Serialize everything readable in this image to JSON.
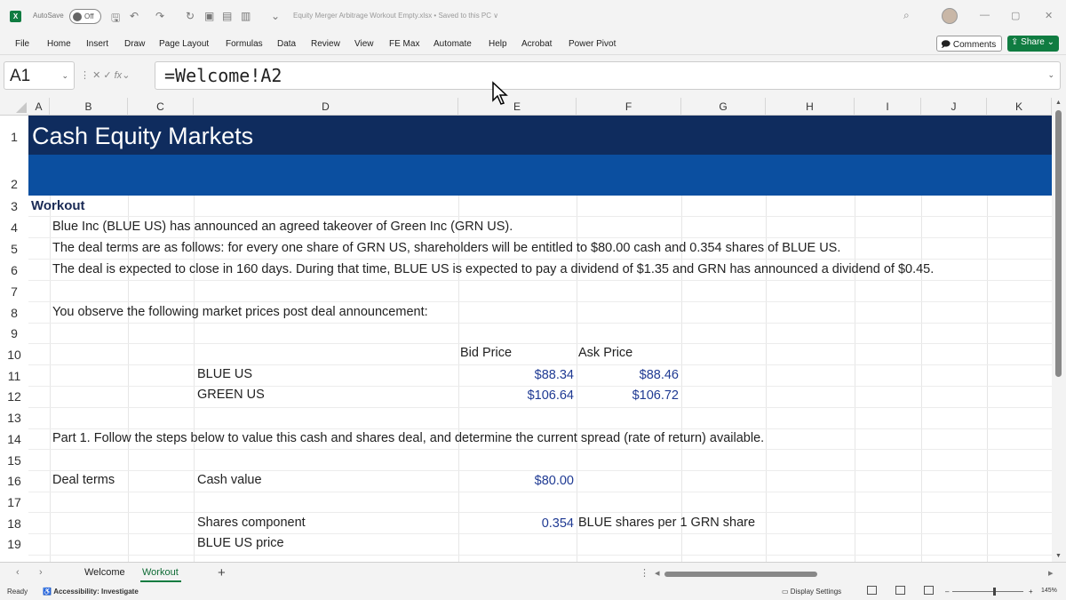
{
  "titlebar": {
    "autosave_label": "AutoSave",
    "autosave_state": "Off",
    "document_title": "Equity Merger Arbitrage Workout Empty.xlsx • Saved to this PC ∨"
  },
  "ribbon": {
    "tabs": [
      "File",
      "Home",
      "Insert",
      "Draw",
      "Page Layout",
      "Formulas",
      "Data",
      "Review",
      "View",
      "FE Max",
      "Automate",
      "Help",
      "Acrobat",
      "Power Pivot"
    ],
    "comments_label": "Comments",
    "share_label": "Share"
  },
  "formula_bar": {
    "name_box": "A1",
    "formula": "=Welcome!A2"
  },
  "columns": [
    "A",
    "B",
    "C",
    "D",
    "E",
    "F",
    "G",
    "H",
    "I",
    "J",
    "K"
  ],
  "rows": [
    "1",
    "2",
    "3",
    "4",
    "5",
    "6",
    "7",
    "8",
    "9",
    "10",
    "11",
    "12",
    "13",
    "14",
    "15",
    "16",
    "17",
    "18",
    "19"
  ],
  "sheet": {
    "title": "Cash Equity Markets",
    "section": "Workout",
    "line4": "Blue Inc (BLUE US) has announced an agreed takeover of Green Inc (GRN US).",
    "line5": "The deal terms are as follows: for every one share of GRN US, shareholders will be entitled to $80.00 cash and 0.354 shares of BLUE US.",
    "line6": "The deal is expected to close in 160 days. During that time, BLUE US is expected to pay a dividend of $1.35 and GRN has announced a dividend of $0.45.",
    "line8": "You observe the following market prices post deal announcement:",
    "bid_header": "Bid Price",
    "ask_header": "Ask Price",
    "blue_label": "BLUE US",
    "blue_bid": "$88.34",
    "blue_ask": "$88.46",
    "green_label": "GREEN US",
    "green_bid": "$106.64",
    "green_ask": "$106.72",
    "line14": "Part 1. Follow the steps below to value this cash and shares deal, and determine the current spread (rate of return) available.",
    "deal_terms": "Deal terms",
    "cash_value_label": "Cash value",
    "cash_value": "$80.00",
    "shares_component_label": "Shares component",
    "shares_component_value": "0.354",
    "shares_note": "BLUE shares per 1 GRN share",
    "blue_price_label": "BLUE US price"
  },
  "sheet_tabs": [
    "Welcome",
    "Workout"
  ],
  "status": {
    "ready": "Ready",
    "accessibility": "Accessibility: Investigate",
    "display_settings": "Display Settings",
    "zoom": "145%"
  },
  "colors": {
    "excel_green": "#107c41",
    "title_band": "#0f2c5e",
    "sub_band": "#0b4fa0",
    "value_blue": "#1f3a93"
  }
}
